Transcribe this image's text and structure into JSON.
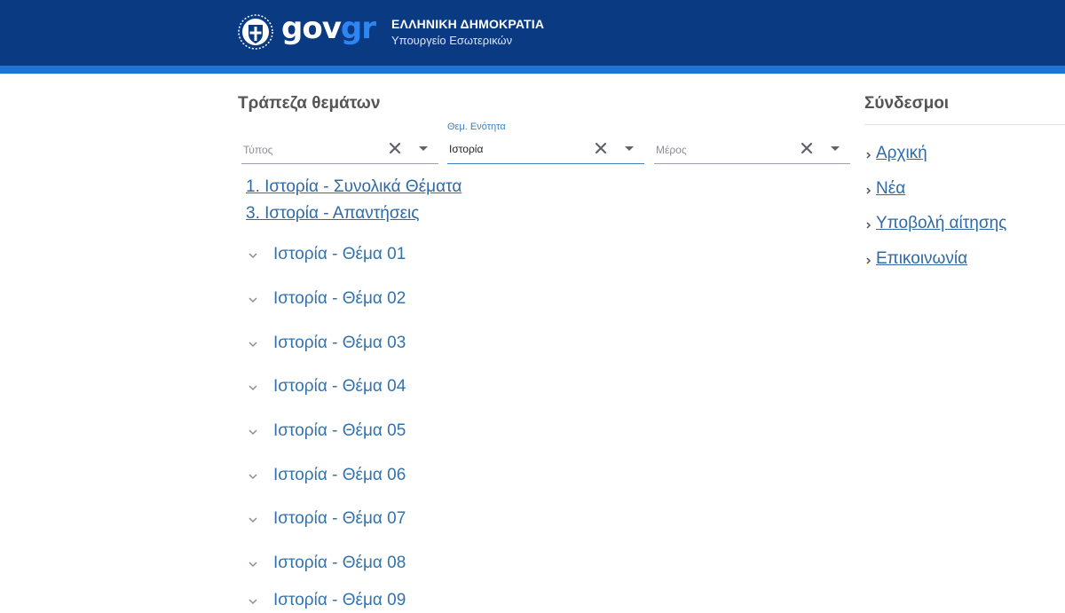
{
  "header": {
    "logo_gov": "gov",
    "logo_gr": "gr",
    "org_title": "ΕΛΛΗΝΙΚΗ ΔΗΜΟΚΡΑΤΙΑ",
    "org_subtitle": "Υπουργείο Εσωτερικών",
    "background_color": "#0a3a82",
    "stripe_color": "#1e73d6"
  },
  "main": {
    "title": "Τράπεζα θεμάτων",
    "filters": [
      {
        "label": "",
        "placeholder": "Τύπος",
        "value": ""
      },
      {
        "label": "Θεμ. Ενότητα",
        "placeholder": "",
        "value": "Ιστορία"
      },
      {
        "label": "",
        "placeholder": "Μέρος",
        "value": ""
      }
    ],
    "links": [
      "1. Ιστορία - Συνολικά Θέματα",
      "3. Ιστορία - Απαντήσεις"
    ],
    "topics": [
      "Ιστορία - Θέμα 01",
      "Ιστορία - Θέμα 02",
      "Ιστορία - Θέμα 03",
      "Ιστορία - Θέμα 04",
      "Ιστορία - Θέμα 05",
      "Ιστορία - Θέμα 06",
      "Ιστορία - Θέμα 07",
      "Ιστορία - Θέμα 08",
      "Ιστορία - Θέμα 09"
    ]
  },
  "sidebar": {
    "title": "Σύνδεσμοι",
    "links": [
      "Αρχική",
      "Νέα",
      "Υποβολή αίτησης",
      "Επικοινωνία"
    ]
  },
  "icons": {
    "emblem": "coat-of-arms-icon",
    "clear": "close-icon",
    "dropdown": "caret-down-icon",
    "expand": "chevron-down-icon",
    "link_arrow": "chevron-right-icon"
  },
  "colors": {
    "link": "#2f6aa6",
    "topic": "#3273ae",
    "accent": "#3a82c4"
  }
}
